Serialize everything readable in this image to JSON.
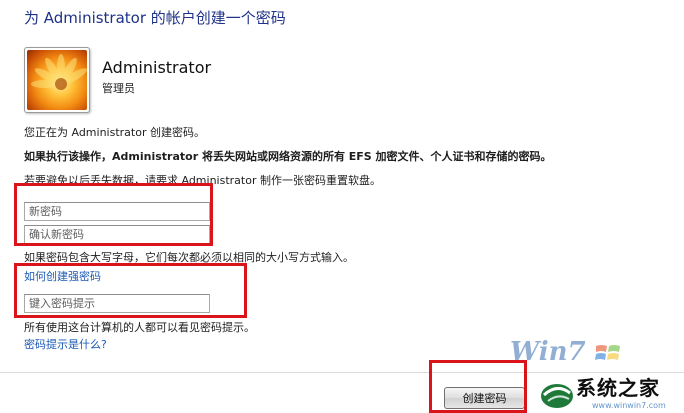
{
  "page": {
    "title": "为 Administrator 的帐户创建一个密码"
  },
  "account": {
    "name": "Administrator",
    "role": "管理员"
  },
  "messages": {
    "creating": "您正在为 Administrator 创建密码。",
    "warning": "如果执行该操作，Administrator 将丢失网站或网络资源的所有 EFS 加密文件、个人证书和存储的密码。",
    "advice": "若要避免以后丢失数据，请要求 Administrator 制作一张密码重置软盘。",
    "case_note": "如果密码包含大写字母，它们每次都必须以相同的大小写方式输入。",
    "hint_note": "所有使用这台计算机的人都可以看见密码提示。"
  },
  "form": {
    "new_password_placeholder": "新密码",
    "confirm_password_placeholder": "确认新密码",
    "hint_placeholder": "键入密码提示"
  },
  "links": {
    "strong_password": "如何创建强密码",
    "what_is_hint": "密码提示是什么?"
  },
  "buttons": {
    "create_password": "创建密码"
  },
  "watermark": {
    "logo_text": "Win7",
    "brand": "系统之家",
    "url": "www.winwin7.com"
  },
  "colors": {
    "title": "#1e3287",
    "link": "#1a58b4",
    "highlight": "#d9141a"
  }
}
